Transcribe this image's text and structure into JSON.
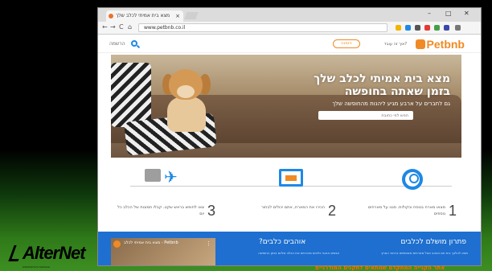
{
  "browser": {
    "tab_title": "מצא בית אמיתי לכלב שלך",
    "tab_close": "×",
    "url": "www.petbnb.co.il",
    "nav_back": "←",
    "nav_forward": "→",
    "nav_reload": "C",
    "nav_home": "⌂",
    "win_min": "–",
    "win_max": "□",
    "win_close": "✕"
  },
  "site": {
    "logo": "Petbnb",
    "header_link": "איך זה עובד?",
    "header_button": "הזמנה",
    "search_label": "הרשמה"
  },
  "hero": {
    "title_line1": "מצא בית אמיתי לכלב שלך",
    "title_line2": "בזמן שאתה בחופשה",
    "subtitle": "גם לחברים על ארבע מגיע ליהנות מהחופשה שלך",
    "input_placeholder": "חפש לפי כתובת"
  },
  "steps": [
    {
      "number": "1",
      "text": "מצאו מארח בנוסח וכקולות. סננו על מארחים נוספים"
    },
    {
      "number": "2",
      "text": "הכירו את המארח, אתם יכולים לבחור"
    },
    {
      "number": "3",
      "text": "צאו לחופש בראש שקט. קבלו תמונות של הכלב כל יום"
    }
  ],
  "blue_section": {
    "title_right": "פתרון מושלם לכלבים",
    "title_left": "אוהבים כלבים?",
    "paragraph_right": "מצא לכלבך בית חם ואוהב אצל מארחים מאומתים ברחבי הארץ",
    "paragraph_left": "אנשים אוהבי כלבים מארחים את הכלב שלכם בזמן החופשה",
    "video_title": "Petbnb - מצא בית אמיתי לכלב",
    "video_menu": "⋮"
  },
  "branding": {
    "logo_text": "AlterNet",
    "logo_sub": "טכנולוגיות ניהול מתקדמות",
    "caption": "אתר הקנייה המתקדם שמתאים לתקנים המודרניים"
  },
  "colors": {
    "accent_orange": "#f08a24",
    "accent_blue": "#1e88e5",
    "blue_section": "#1e6fd0",
    "caption_orange": "#ff6a00"
  }
}
